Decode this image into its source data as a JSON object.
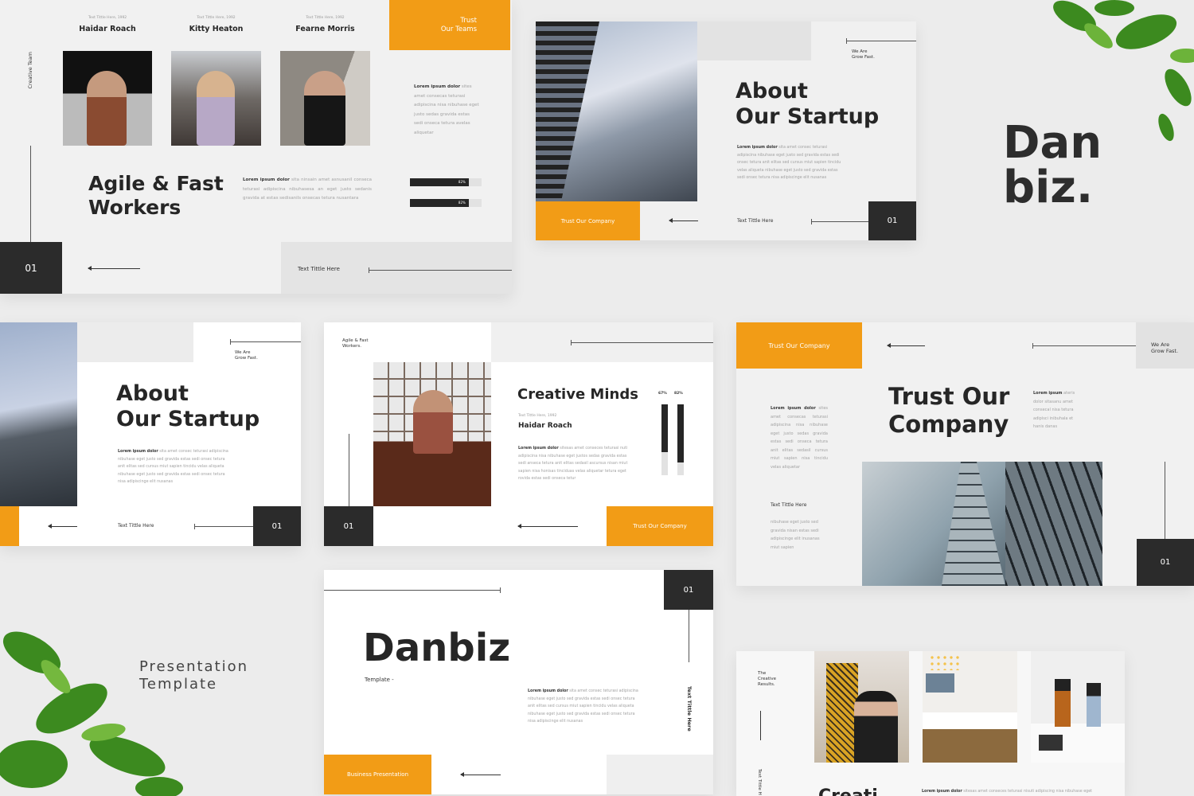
{
  "colors": {
    "accent": "#f29c16",
    "dark": "#2b2b2b"
  },
  "brand": {
    "line1": "Dan",
    "line2": "biz."
  },
  "tagline": {
    "line1": "Presentation",
    "line2": "Template"
  },
  "slide_team": {
    "members": [
      {
        "caption": "Text Tittle Here, 1992",
        "name": "Haidar Roach"
      },
      {
        "caption": "Text Tittle Here, 1992",
        "name": "Kitty Heaton"
      },
      {
        "caption": "Text Tittle Here, 1992",
        "name": "Fearne Morris"
      }
    ],
    "badge": {
      "line1": "Trust",
      "line2": "Our Teams"
    },
    "side_label": "Creative Team",
    "intro_bold": "Lorem ipsum dolor",
    "intro": " sites amet consecas teturasi adipiscina nisa nibuhase eget justo sedas gravida estas sedi onseca tetura avelas aliquetar",
    "title_line1": "Agile & Fast",
    "title_line2": "Workers",
    "body_bold": "Lorem ipsum dolor",
    "body": " sita ninsain amet asnusanil conseca teturasi adipiscina nibuhasesa an eget justo sedanis gravida at estas sedisanils onsecas tetura nusantara",
    "progress": [
      {
        "label": "82%",
        "value": 82
      },
      {
        "label": "82%",
        "value": 82
      }
    ],
    "page": "01",
    "footer_title": "Text Tittle Here"
  },
  "slide_about1": {
    "tag": "Trust Our Company",
    "we_are": "We Are",
    "grow": "Grow Fast.",
    "title_line1": "About",
    "title_line2": "Our Startup",
    "body_bold": "Lorem ipsum dolor",
    "body": " sita amet consec teturasi adipiscina nibuhase eget justo sed gravida estas sedi onsec tetura anit elitas sed cursus miut sapien tincidu velas aliqueta nibuhase eget justo sed gravida estas sedi onsec tetura nisa adipiscinge elit nusanas",
    "footer_title": "Text Tittle Here",
    "page": "01"
  },
  "slide_about2": {
    "we_are": "We Are",
    "grow": "Grow Fast.",
    "title_line1": "About",
    "title_line2": "Our Startup",
    "body_bold": "Lorem ipsum dolor",
    "body": " sita amet consec teturasi adipiscina nibuhase eget justo sed gravida estas sedi onsec tetura anit elitas sed cursus miut sapien tincidu velas aliqueta nibuhase eget justo sed gravida estas sedi onsec tetura nisa adipiscinge elit nusanas",
    "footer_title": "Text Tittle Here",
    "page": "01"
  },
  "slide_minds": {
    "corner_line1": "Agile & Fast",
    "corner_line2": "Workers.",
    "title": "Creative Minds",
    "caption": "Text Tittle Here, 1992",
    "name": "Haidar Roach",
    "body_bold": "Lorem ipsum dolor",
    "body": " sitesas amet conseces teturasi nuti adipiscina nisa nibuhase eget justos sedas gravida estas sedi anseca tetura anit elitas sedasil ascursus nisan miut sapien nisa honisas tinciduas velas aliquetar tetura eget rovida estas sedi onseca tetur",
    "bars": [
      {
        "label": "67%",
        "value": 67
      },
      {
        "label": "82%",
        "value": 82
      }
    ],
    "page": "01",
    "tag": "Trust Our Company"
  },
  "slide_cover": {
    "page": "01",
    "vertical_title": "Text Tittle Here",
    "title": "Danbiz",
    "subtitle": "Template -",
    "body_bold": "Lorem ipsum dolor",
    "body": " sita amet consec teturasi adipiscina nibuhase eget justo sed gravida estas sedi onsec tetura anit elitas sed cursus miut sapien tincidu velas aliqueta nibuhase eget justo sed gravida estas sedi onsec tetura nisa adipiscinge elit nusanas",
    "tag": "Business Presentation"
  },
  "slide_trust": {
    "tag": "Trust Our Company",
    "we_are": "We Are",
    "grow": "Grow Fast.",
    "title_line1": "Trust Our",
    "title_line2": "Company",
    "right_bold": "Lorem ipsum",
    "right": " ateris dolor sitasanu amet consecal nisa tetura adipisci inibuhala et hanis danas",
    "left_bold": "Lorem ipsum dolor",
    "left": " sites amet consecas teturasi adipiscina nisa nibuhase eget justo sedas gravida estas sedi onseca tetura anit elitas sedasil cursus miut sapien nisa tincidu velas aliquetar",
    "sub_title": "Text Tittle Here",
    "sub_body": "nibuhase eget justo sed gravida nisan estas sedi adipiscinge elit inusanas miut sapien",
    "page": "01"
  },
  "slide_results": {
    "label_line1": "The",
    "label_line2": "Creative",
    "label_line3": "Results.",
    "vertical_title": "Text Tittle H",
    "heading": "Creati",
    "body_bold": "Lorem ipsum dolor",
    "body": " sitesas amet conseces teturasi nisuti adipiscing nisa nibuhase eget"
  }
}
